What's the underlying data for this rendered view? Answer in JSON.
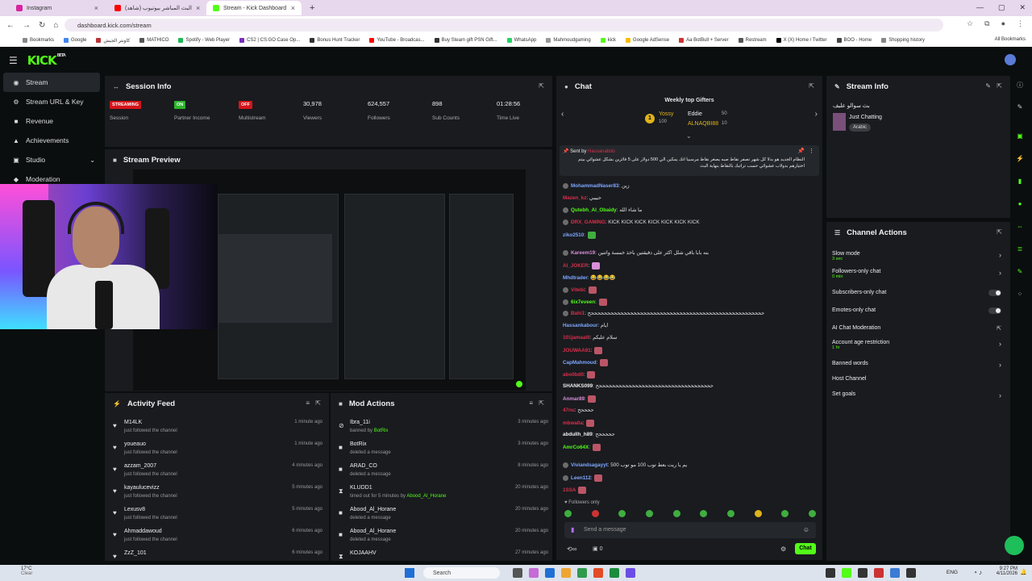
{
  "browser": {
    "tabs": [
      {
        "label": "Instagram",
        "color": "#d6249f"
      },
      {
        "label": "(شاهد) البث المباشر بيوتيوب",
        "color": "#ff0000"
      },
      {
        "label": "Stream - Kick Dashboard",
        "color": "#53fc18"
      }
    ],
    "new_tab": "+",
    "url": "dashboard.kick.com/stream",
    "bookmarks": [
      "Bookmarks",
      "Google",
      "كاونتر الجيش",
      "MATHICO",
      "Spotify - Web Player",
      "CS2 | CS:GO Case Op...",
      "Bonus Hunt Tracker",
      "YouTube - Broadcas...",
      "Buy Steam gift PSN Gift...",
      "WhatsApp",
      "Mahmoudgaming",
      "kick",
      "Google AdSense",
      "Aa BotBull + Server",
      "Restream",
      "X (X) Home / Twitter",
      "BOO - Home",
      "Shopping history"
    ],
    "all_bookmarks": "All Bookmarks"
  },
  "app": {
    "logo": "KICK",
    "beta": "BETA"
  },
  "sidebar": {
    "items": [
      {
        "label": "Stream",
        "icon": "broadcast-icon"
      },
      {
        "label": "Stream URL & Key",
        "icon": "key-icon"
      },
      {
        "label": "Revenue",
        "icon": "dollar-icon"
      },
      {
        "label": "Achievements",
        "icon": "trophy-icon"
      },
      {
        "label": "Studio",
        "icon": "studio-icon"
      },
      {
        "label": "Moderation",
        "icon": "shield-icon"
      }
    ]
  },
  "session": {
    "title": "Session Info",
    "stats": [
      {
        "badge": "STREAMING",
        "label": "Session",
        "badge_color": "red"
      },
      {
        "badge": "ON",
        "label": "Partner Income",
        "badge_color": "green"
      },
      {
        "badge": "OFF",
        "label": "Multistream",
        "badge_color": "red"
      },
      {
        "value": "30,978",
        "label": "Viewers"
      },
      {
        "value": "624,557",
        "label": "Followers"
      },
      {
        "value": "898",
        "label": "Sub Counts"
      },
      {
        "value": "01:28:56",
        "label": "Time Live"
      }
    ]
  },
  "preview": {
    "title": "Stream Preview"
  },
  "activity": {
    "title": "Activity Feed",
    "rows": [
      {
        "name": "M14LK",
        "desc": "just followed the channel",
        "time": "1 minute ago"
      },
      {
        "name": "youeauo",
        "desc": "just followed the channel",
        "time": "1 minute ago"
      },
      {
        "name": "azzam_2007",
        "desc": "just followed the channel",
        "time": "4 minutes ago"
      },
      {
        "name": "kayaulucevizz",
        "desc": "just followed the channel",
        "time": "5 minutes ago"
      },
      {
        "name": "Lexusv8",
        "desc": "just followed the channel",
        "time": "5 minutes ago"
      },
      {
        "name": "Ahmaddawoud",
        "desc": "just followed the channel",
        "time": "6 minutes ago"
      },
      {
        "name": "ZzZ_101",
        "desc": "",
        "time": "6 minutes ago"
      }
    ]
  },
  "mod": {
    "title": "Mod Actions",
    "rows": [
      {
        "name": "Ibra_11i",
        "desc": "banned by ",
        "by": "BotRix",
        "time": "3 minutes ago",
        "icon": "ban-icon"
      },
      {
        "name": "BotRix",
        "desc": "deleted a message",
        "by": "",
        "time": "3 minutes ago",
        "icon": "trash-icon"
      },
      {
        "name": "ARAD_CO",
        "desc": "deleted a message",
        "by": "",
        "time": "8 minutes ago",
        "icon": "trash-icon"
      },
      {
        "name": "KLUDD1",
        "desc": "timed out for 5 minutes by ",
        "by": "Abood_Al_Horane",
        "time": "20 minutes ago",
        "icon": "hourglass-icon"
      },
      {
        "name": "Abood_Al_Horane",
        "desc": "deleted a message",
        "by": "",
        "time": "20 minutes ago",
        "icon": "trash-icon"
      },
      {
        "name": "Abood_Al_Horane",
        "desc": "deleted a message",
        "by": "",
        "time": "20 minutes ago",
        "icon": "trash-icon"
      },
      {
        "name": "KOJAAHV",
        "desc": "",
        "by": "",
        "time": "27 minutes ago",
        "icon": "hourglass-icon"
      }
    ]
  },
  "chat": {
    "title": "Chat",
    "gifters_title": "Weekly top Gifters",
    "gifters": [
      {
        "rank": "1",
        "name": "Yossy",
        "count": "100"
      },
      {
        "rank": "",
        "name": "Eddie",
        "count": "50"
      },
      {
        "rank": "",
        "name": "ALNAQBI88",
        "count": "10"
      }
    ],
    "pinned_by": "Sent by",
    "pinned_user": "Hassanabdo",
    "pinned_text": "النظام الجديد هو بدلا كل شهر تصفر نقاط صبه يصغر نقاط مرسبيا اتك يمكين الي 500 دولار على 5 فائزين بشكل عشوائي بيتم اختيارهم بدولاب عشوائي حسب تراتبك بالنقاط بنهاية البث",
    "messages": [
      {
        "user": "MohammadNaser83",
        "color": "#7ea7ff",
        "text": "زين"
      },
      {
        "user": "Mazen_kz",
        "color": "#d9304a",
        "text": "حبيبي"
      },
      {
        "user": "Qutebh_Al_Obaidy",
        "color": "#53fc18",
        "text": "ما شاء الله"
      },
      {
        "user": "DRX_GAMING",
        "color": "#d9304a",
        "text": "KICK KICK KICK KICK KICK KICK KICK"
      },
      {
        "user": "ziko2510",
        "color": "#7ea7ff",
        "text": ""
      },
      {
        "user": "Kareem19",
        "color": "#d98fd9",
        "text": "بنه بابا باقي شلل اكثر على دقيقتين باخذ خمسة واتنين"
      },
      {
        "user": "Al_JOKER",
        "color": "#d9304a",
        "text": ""
      },
      {
        "user": "Mhdtrader",
        "color": "#7ea7ff",
        "text": "😂😂😂😂"
      },
      {
        "user": "Vitebi",
        "color": "#d9304a",
        "text": ""
      },
      {
        "user": "6ix7eveen",
        "color": "#53fc18",
        "text": ""
      },
      {
        "user": "Bahi1",
        "color": "#d9304a",
        "text": "حححححححححححححححححححححححححححححححححححححححححححححححححححححح"
      },
      {
        "user": "Hassankabour",
        "color": "#7ea7ff",
        "text": "ايام"
      },
      {
        "user": "101jamaalll",
        "color": "#d9304a",
        "text": "سلام عليكم"
      },
      {
        "user": "JOUWAA91",
        "color": "#d9304a",
        "text": ""
      },
      {
        "user": "CapMahmoud",
        "color": "#7ea7ff",
        "text": ""
      },
      {
        "user": "abo0bd0",
        "color": "#d9304a",
        "text": ""
      },
      {
        "user": "SHANKS099",
        "color": "#eeeeee",
        "text": "حححححححححححححححححححححححححححححححححححح"
      },
      {
        "user": "Anmar89",
        "color": "#d98fd9",
        "text": ""
      },
      {
        "user": "47nu",
        "color": "#d9304a",
        "text": "ححححح"
      },
      {
        "user": "mbwa0a",
        "color": "#d9304a",
        "text": ""
      },
      {
        "user": "abdullh_h89",
        "color": "#eeeeee",
        "text": "حححححح"
      },
      {
        "user": "AmrCo64X",
        "color": "#53fc18",
        "text": ""
      },
      {
        "user": "Viviandsagayyt",
        "color": "#7ea7ff",
        "text": "يم يا ريت بعط توب 100 مو توب 500"
      },
      {
        "user": "Leen112",
        "color": "#7ea7ff",
        "text": ""
      },
      {
        "user": "1SSA",
        "color": "#d9304a",
        "text": ""
      }
    ],
    "followers_only": "Followers only",
    "placeholder": "Send a message",
    "chat_button": "Chat",
    "count": "0"
  },
  "stream_info": {
    "title": "Stream Info",
    "stream_title": "بث سوالو عليف",
    "category": "Just Chatting",
    "language": "Arabic"
  },
  "channel_actions": {
    "title": "Channel Actions",
    "items": [
      {
        "label": "Slow mode",
        "sub": "3 sec",
        "control": "chevron"
      },
      {
        "label": "Followers-only chat",
        "sub": "0 min",
        "control": "chevron"
      },
      {
        "label": "Subscribers-only chat",
        "sub": "",
        "control": "toggle"
      },
      {
        "label": "Emotes-only chat",
        "sub": "",
        "control": "toggle"
      },
      {
        "label": "AI Chat Moderation",
        "sub": "",
        "control": "external"
      },
      {
        "label": "Account age restriction",
        "sub": "1 hr",
        "control": "chevron"
      },
      {
        "label": "Banned words",
        "sub": "",
        "control": "chevron"
      },
      {
        "label": "Host Channel",
        "sub": "",
        "control": "none"
      },
      {
        "label": "Set goals",
        "sub": "",
        "control": "chevron"
      }
    ]
  },
  "taskbar": {
    "weather": "17°C",
    "weather_sub": "Clear",
    "search": "Search",
    "lang": "ENG",
    "time": "9:27 PM",
    "date": "4/11/2026"
  },
  "colors": {
    "accent": "#53fc18",
    "panel": "#191b1f",
    "bg": "#0b0e0f",
    "live_red": "#d4141a"
  }
}
